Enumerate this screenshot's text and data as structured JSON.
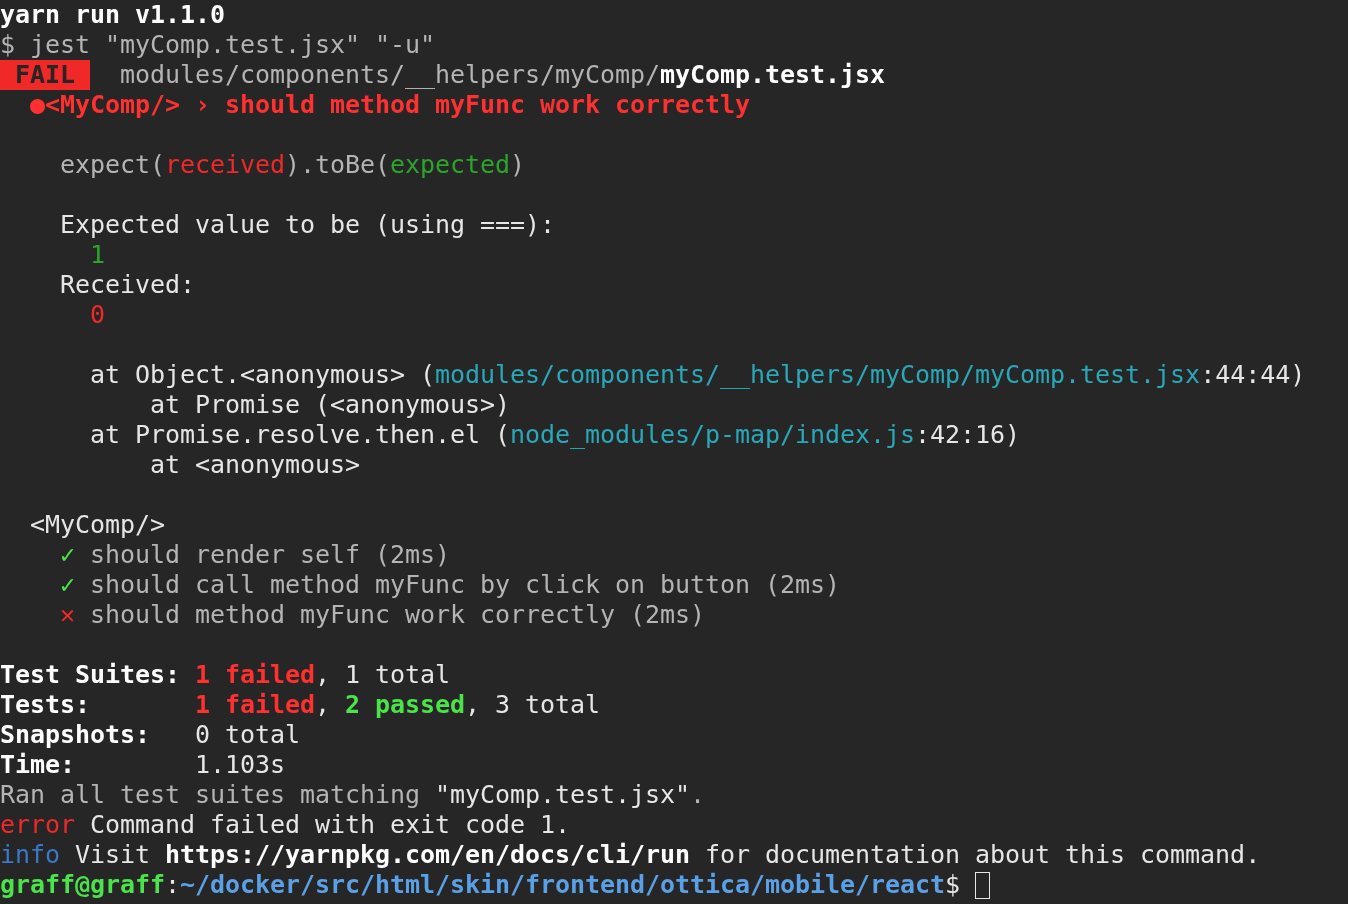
{
  "terminal": {
    "lines": [
      {
        "kind": "text",
        "segments": [
          {
            "text": "yarn run v1.1.0",
            "kind": "bold"
          }
        ]
      },
      {
        "kind": "text",
        "segments": [
          {
            "text": "$ jest \"myComp.test.jsx\" \"-u\"",
            "kind": "dim"
          }
        ]
      },
      {
        "kind": "text",
        "segments": [
          {
            "text": "FAIL",
            "kind": "badge"
          },
          {
            "text": " modules/components/__helpers/myComp/",
            "kind": "dim"
          },
          {
            "text": "myComp.test.jsx",
            "kind": "bold"
          }
        ]
      },
      {
        "kind": "text",
        "segments": [
          {
            "text": "  ●<MyComp/> › should method myFunc work correctly",
            "kind": "error"
          }
        ]
      },
      {
        "kind": "blank"
      },
      {
        "kind": "text",
        "segments": [
          {
            "text": "    expect(",
            "kind": "dim"
          },
          {
            "text": "received",
            "kind": "red"
          },
          {
            "text": ").toBe(",
            "kind": "dim"
          },
          {
            "text": "expected",
            "kind": "green"
          },
          {
            "text": ")",
            "kind": "dim"
          }
        ]
      },
      {
        "kind": "blank"
      },
      {
        "kind": "text",
        "segments": [
          {
            "text": "    Expected value to be (using ===):",
            "kind": "normal"
          }
        ]
      },
      {
        "kind": "text",
        "segments": [
          {
            "text": "      1",
            "kind": "green"
          }
        ]
      },
      {
        "kind": "text",
        "segments": [
          {
            "text": "    Received:",
            "kind": "normal"
          }
        ]
      },
      {
        "kind": "text",
        "segments": [
          {
            "text": "      0",
            "kind": "red"
          }
        ]
      },
      {
        "kind": "blank"
      },
      {
        "kind": "text",
        "segments": [
          {
            "text": "      at Object.<anonymous> (",
            "kind": "normal"
          },
          {
            "text": "modules/components/__helpers/myComp/myComp.test.jsx",
            "kind": "path"
          },
          {
            "text": ":44:44)",
            "kind": "normal"
          }
        ]
      },
      {
        "kind": "text",
        "segments": [
          {
            "text": "          at Promise (<anonymous>)",
            "kind": "normal"
          }
        ]
      },
      {
        "kind": "text",
        "segments": [
          {
            "text": "      at Promise.resolve.then.el (",
            "kind": "normal"
          },
          {
            "text": "node_modules/p-map/index.js",
            "kind": "path"
          },
          {
            "text": ":42:16)",
            "kind": "normal"
          }
        ]
      },
      {
        "kind": "text",
        "segments": [
          {
            "text": "          at <anonymous>",
            "kind": "normal"
          }
        ]
      },
      {
        "kind": "blank"
      },
      {
        "kind": "text",
        "segments": [
          {
            "text": "  <MyComp/>",
            "kind": "normal"
          }
        ]
      },
      {
        "kind": "text",
        "segments": [
          {
            "text": "    ✓",
            "kind": "pass"
          },
          {
            "text": " should render self (2ms)",
            "kind": "dim"
          }
        ]
      },
      {
        "kind": "text",
        "segments": [
          {
            "text": "    ✓",
            "kind": "pass"
          },
          {
            "text": " should call method myFunc by click on button (2ms)",
            "kind": "dim"
          }
        ]
      },
      {
        "kind": "text",
        "segments": [
          {
            "text": "    ✕",
            "kind": "red"
          },
          {
            "text": " should method myFunc work correctly (2ms)",
            "kind": "dim"
          }
        ]
      },
      {
        "kind": "blank"
      },
      {
        "kind": "text",
        "segments": [
          {
            "text": "Test Suites: ",
            "kind": "bold"
          },
          {
            "text": "1 failed",
            "kind": "error"
          },
          {
            "text": ", 1 total",
            "kind": "normal"
          }
        ]
      },
      {
        "kind": "text",
        "segments": [
          {
            "text": "Tests:       ",
            "kind": "bold"
          },
          {
            "text": "1 failed",
            "kind": "error"
          },
          {
            "text": ", ",
            "kind": "normal"
          },
          {
            "text": "2 passed",
            "kind": "pass"
          },
          {
            "text": ", 3 total",
            "kind": "normal"
          }
        ]
      },
      {
        "kind": "text",
        "segments": [
          {
            "text": "Snapshots:   ",
            "kind": "bold"
          },
          {
            "text": "0 total",
            "kind": "normal"
          }
        ]
      },
      {
        "kind": "text",
        "segments": [
          {
            "text": "Time:        ",
            "kind": "bold"
          },
          {
            "text": "1.103s",
            "kind": "normal"
          }
        ]
      },
      {
        "kind": "text",
        "segments": [
          {
            "text": "Ran all test suites matching ",
            "kind": "dim"
          },
          {
            "text": "\"myComp.test.jsx\"",
            "kind": "normal"
          },
          {
            "text": ".",
            "kind": "dim"
          }
        ]
      },
      {
        "kind": "text",
        "segments": [
          {
            "text": "error",
            "kind": "red"
          },
          {
            "text": " Command failed with exit code 1.",
            "kind": "normal"
          }
        ]
      },
      {
        "kind": "text",
        "segments": [
          {
            "text": "info",
            "kind": "info"
          },
          {
            "text": " Visit ",
            "kind": "normal"
          },
          {
            "text": "https://yarnpkg.com/en/docs/cli/run",
            "kind": "bold"
          },
          {
            "text": " for documentation about this command.",
            "kind": "normal"
          }
        ]
      },
      {
        "kind": "text",
        "segments": [
          {
            "text": "graff@graff",
            "kind": "pass"
          },
          {
            "text": ":",
            "kind": "normal"
          },
          {
            "text": "~/docker/src/html/skin/frontend/ottica/mobile/react",
            "kind": "cwd"
          },
          {
            "text": "$",
            "kind": "normal"
          }
        ],
        "cursor": true
      }
    ]
  }
}
